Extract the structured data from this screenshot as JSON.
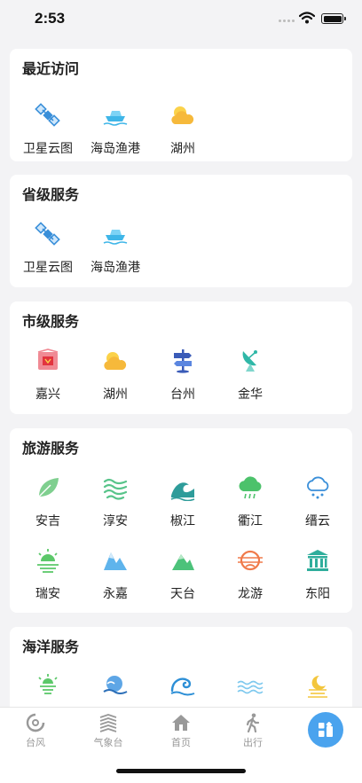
{
  "status": {
    "time": "2:53"
  },
  "sections": [
    {
      "title": "最近访问",
      "items": [
        {
          "label": "卫星云图",
          "icon": "satellite-icon"
        },
        {
          "label": "海岛渔港",
          "icon": "ship-icon"
        },
        {
          "label": "湖州",
          "icon": "sun-cloud-icon"
        }
      ]
    },
    {
      "title": "省级服务",
      "items": [
        {
          "label": "卫星云图",
          "icon": "satellite-icon"
        },
        {
          "label": "海岛渔港",
          "icon": "ship-icon"
        }
      ]
    },
    {
      "title": "市级服务",
      "items": [
        {
          "label": "嘉兴",
          "icon": "flag-icon"
        },
        {
          "label": "湖州",
          "icon": "sun-cloud-icon"
        },
        {
          "label": "台州",
          "icon": "signpost-icon"
        },
        {
          "label": "金华",
          "icon": "radar-dish-icon"
        }
      ]
    },
    {
      "title": "旅游服务",
      "items": [
        {
          "label": "安吉",
          "icon": "leaf-icon"
        },
        {
          "label": "淳安",
          "icon": "wind-waves-icon"
        },
        {
          "label": "椒江",
          "icon": "wave-icon"
        },
        {
          "label": "衢江",
          "icon": "rain-cloud-icon"
        },
        {
          "label": "缙云",
          "icon": "rain-cloud-outline-icon"
        },
        {
          "label": "瑞安",
          "icon": "sunrise-icon"
        },
        {
          "label": "永嘉",
          "icon": "mountain-icon"
        },
        {
          "label": "天台",
          "icon": "mountain-green-icon"
        },
        {
          "label": "龙游",
          "icon": "ring-icon"
        },
        {
          "label": "东阳",
          "icon": "temple-icon"
        }
      ]
    },
    {
      "title": "海洋服务",
      "items": [
        {
          "label": "",
          "icon": "lighthouse-icon"
        },
        {
          "label": "",
          "icon": "sea-wave-circle-icon"
        },
        {
          "label": "",
          "icon": "wave-curl-icon"
        },
        {
          "label": "",
          "icon": "ripples-icon"
        },
        {
          "label": "",
          "icon": "moon-waves-icon"
        }
      ]
    }
  ],
  "tabs": [
    {
      "label": "台风",
      "icon": "typhoon-icon"
    },
    {
      "label": "气象台",
      "icon": "observatory-icon"
    },
    {
      "label": "首页",
      "icon": "home-icon"
    },
    {
      "label": "出行",
      "icon": "walking-icon"
    }
  ],
  "fab": {
    "icon": "apps-icon"
  },
  "colors": {
    "accent": "#4aa3ee",
    "background": "#f3f3f5",
    "card": "#ffffff"
  }
}
